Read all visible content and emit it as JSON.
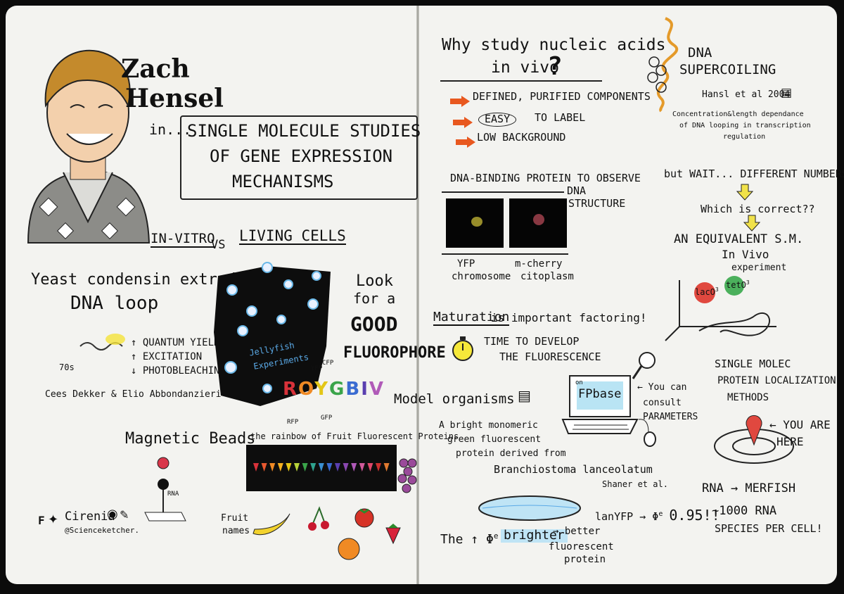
{
  "speaker": {
    "first_name": "Zach",
    "last_name": "Hensel"
  },
  "intro": "in...",
  "talk_title": [
    "SINGLE MOLECULE STUDIES",
    "OF GENE EXPRESSION",
    "MECHANISMS"
  ],
  "invitro_vs": {
    "left": "IN-VITRO",
    "mid": "VS",
    "right": "LIVING CELLS"
  },
  "yeast": {
    "line1": "Yeast condensin extrudes a",
    "line2": "DNA loop"
  },
  "yield": {
    "items": [
      "QUANTUM YIELD",
      "EXCITATION",
      "PHOTOBLEACHING"
    ],
    "axis_label": "70s"
  },
  "researchers": "Cees Dekker & Elio Abbondanzieri",
  "jellyfish": {
    "line1": "Jellyfish",
    "line2": "Experiments",
    "rfp": "RFP",
    "gfp": "GFP",
    "cfp": "CFP",
    "yfp": "YFP"
  },
  "look_for": [
    "Look",
    "for a",
    "GOOD",
    "FLUOROPHORE"
  ],
  "roygbiv": {
    "letters": [
      "R",
      "O",
      "Y",
      "G",
      "B",
      "I",
      "V"
    ],
    "colors": [
      "#d8323a",
      "#f08a24",
      "#e3c617",
      "#3aa44a",
      "#3a6bd1",
      "#5a3fb0",
      "#b05ab8"
    ]
  },
  "rainbow_caption": "the rainbow of Fruit Fluorescent Proteins",
  "magnetic_beads": {
    "label": "Magnetic Beads",
    "rna": "RNA"
  },
  "fruit_names": [
    "Fruit",
    "names"
  ],
  "credit": {
    "f": "F",
    "name": "Cirenia",
    "handle": "@Scienceketcher."
  },
  "why_study": {
    "line1": "Why study nucleic acids",
    "line2": "in vivo",
    "qmark": "?"
  },
  "reasons": [
    "DEFINED, PURIFIED COMPONENTS",
    "EASY",
    "TO LABEL",
    "LOW BACKGROUND"
  ],
  "dna_binding": {
    "line1": "DNA-BINDING PROTEIN TO OBSERVE",
    "line2": "DNA",
    "line3": "STRUCTURE"
  },
  "micro": {
    "left": [
      "YFP",
      "chromosome"
    ],
    "right": [
      "m-cherry",
      "citoplasm"
    ]
  },
  "maturation": {
    "word": "Maturation",
    "rest": "is important factoring!",
    "time1": "TIME TO DEVELOP",
    "time2": "THE FLUORESCENCE"
  },
  "model_organisms": "Model organisms",
  "bright_protein": [
    "A bright monomeric",
    "green fluorescent",
    "protein derived from",
    "Branchiostoma lanceolatum",
    "Shaner et al."
  ],
  "fpbase": {
    "on": "on",
    "name": "FPbase",
    "consult": [
      "You can",
      "consult",
      "PARAMETERS"
    ]
  },
  "supercoiling": {
    "title1": "DNA",
    "title2": "SUPERCOILING",
    "ref": "Hansl et al 2004",
    "note1": "Concentration&length dependance",
    "note2": "of DNA looping in transcription",
    "note3": "regulation"
  },
  "but_wait": {
    "line1": "but WAIT... DIFFERENT NUMBERS??",
    "line2": "Which is correct??",
    "line3": "AN EQUIVALENT S.M.",
    "line4": "In Vivo",
    "line5": "experiment"
  },
  "lac": {
    "lacO": "lacO",
    "exp": "3",
    "tetO": "tetO",
    "exp2": "3"
  },
  "single_molec": [
    "SINGLE MOLEC",
    "PROTEIN LOCALIZATION",
    "METHODS"
  ],
  "you_are_here": [
    "YOU ARE",
    "HERE"
  ],
  "rna_merfish": {
    "line1": "RNA → MERFISH",
    "line2": "~1000 RNA",
    "line3": "SPECIES PER CELL!"
  },
  "brighter": {
    "prefix": "The ↑ Φ",
    "sup": "e",
    "word": "brighter",
    "better": "better",
    "fp1": "fluorescent",
    "fp2": "protein"
  },
  "lanyfp": "lanYFP → Φ",
  "lanyfp_sup": "e",
  "lanyfp_tail": "0.95!!"
}
